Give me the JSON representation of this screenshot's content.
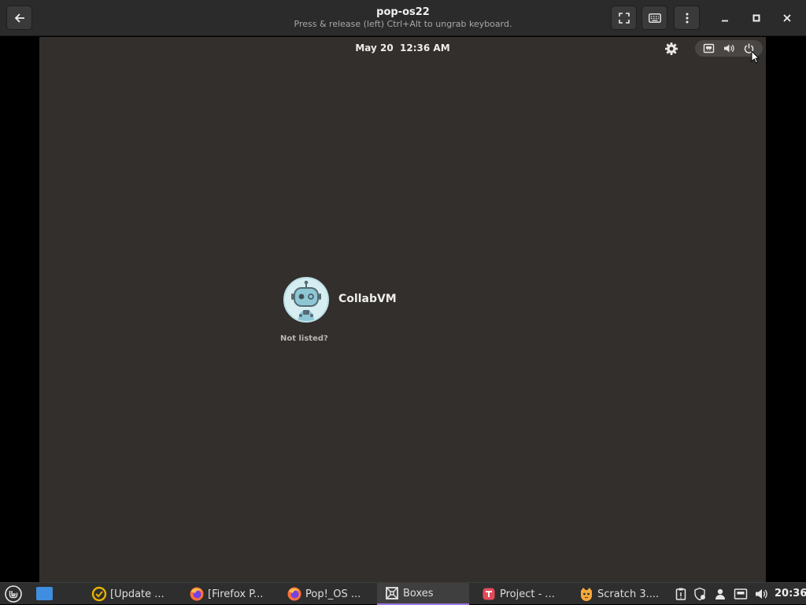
{
  "window": {
    "title": "pop-os22",
    "subtitle": "Press & release (left) Ctrl+Alt to ungrab keyboard."
  },
  "header_icons": {
    "back": "back-arrow-icon",
    "fullscreen": "fullscreen-icon",
    "keyboard": "keyboard-icon",
    "menu": "kebab-menu-icon",
    "minimize": "minimize-icon",
    "maximize": "maximize-icon",
    "close": "close-icon"
  },
  "vm": {
    "clock": "May 20  12:36 AM",
    "user": {
      "name": "CollabVM",
      "avatar": "robot-avatar"
    },
    "not_listed": "Not listed?",
    "tray_icons": [
      "network-icon",
      "volume-icon",
      "power-icon"
    ]
  },
  "taskbar": {
    "tasks": [
      {
        "label": "[Update ...",
        "icon": "update-manager-icon",
        "active": false
      },
      {
        "label": "[Firefox P...",
        "icon": "firefox-icon",
        "active": false
      },
      {
        "label": "Pop!_OS ...",
        "icon": "firefox-icon",
        "active": false
      },
      {
        "label": "Boxes",
        "icon": "boxes-icon",
        "active": true
      },
      {
        "label": "Project - ...",
        "icon": "project-icon",
        "active": false
      },
      {
        "label": "Scratch 3....",
        "icon": "scratch-icon",
        "active": false
      }
    ],
    "clock": "20:36"
  },
  "colors": {
    "vm_background": "#332f2c",
    "accent_active_task": "#9b7be0",
    "desktop_button": "#3f8ee0"
  }
}
